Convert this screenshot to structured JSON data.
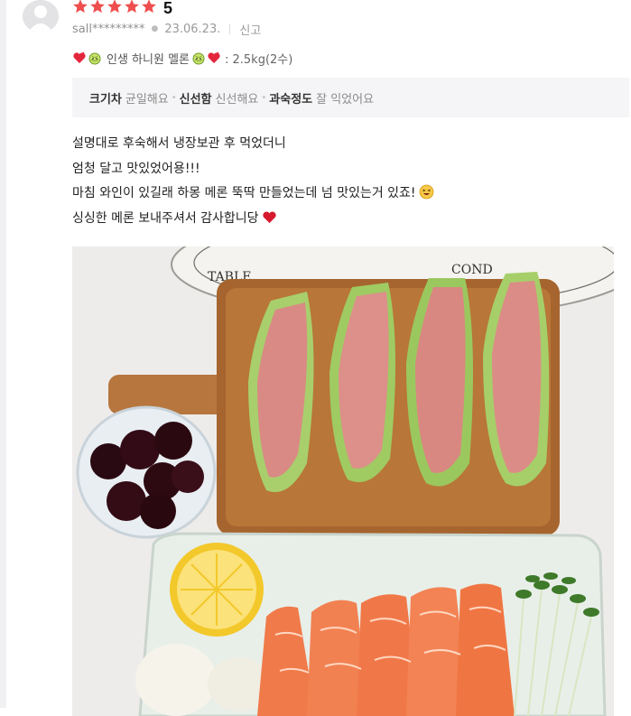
{
  "review": {
    "rating": "5",
    "star_count": 5,
    "star_color": "#ef4e4e",
    "user": "sall*********",
    "date": "23.06.23.",
    "report_label": "신고",
    "option": {
      "left_icons": [
        "heart-icon",
        "melon-icon"
      ],
      "name": "인생 하니원 멜론",
      "right_icons": [
        "melon-icon",
        "heart-icon"
      ],
      "detail": ": 2.5kg(2수)"
    },
    "attributes": [
      {
        "key": "크기차",
        "value": "균일해요"
      },
      {
        "key": "신선함",
        "value": "신선해요"
      },
      {
        "key": "과숙정도",
        "value": "잘 익었어요"
      }
    ],
    "body_lines": [
      "설명대로 후숙해서 냉장보관 후 먹었더니",
      "엄청 달고 맛있었어용!!!",
      "마침 와인이 있길래 하몽 메론 뚝딱 만들었는데 넘 맛있는거 있죠!",
      "싱싱한 메론 보내주셔서 감사합니당"
    ],
    "body_line_icons": [
      "",
      "",
      "laughing-face-icon",
      "heart-icon"
    ],
    "photo_subject": "photo-jamon-melon-salmon-plate"
  }
}
